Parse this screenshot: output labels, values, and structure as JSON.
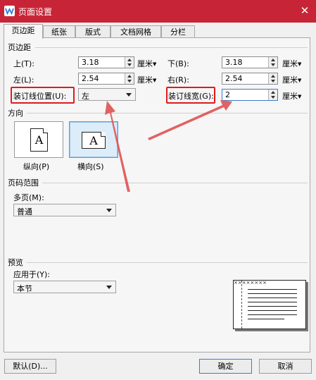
{
  "window": {
    "title": "页面设置",
    "icon": "wps-writer-icon",
    "close_glyph": "✕",
    "title_color": "#c72537"
  },
  "tabs": [
    {
      "label": "页边距",
      "active": true
    },
    {
      "label": "纸张",
      "active": false
    },
    {
      "label": "版式",
      "active": false
    },
    {
      "label": "文档网格",
      "active": false
    },
    {
      "label": "分栏",
      "active": false
    }
  ],
  "margins": {
    "section_title": "页边距",
    "top": {
      "label": "上(T):",
      "value": "3.18",
      "unit": "厘米"
    },
    "bottom": {
      "label": "下(B):",
      "value": "3.18",
      "unit": "厘米"
    },
    "left": {
      "label": "左(L):",
      "value": "2.54",
      "unit": "厘米"
    },
    "right": {
      "label": "右(R):",
      "value": "2.54",
      "unit": "厘米"
    },
    "gutter_position": {
      "label": "装订线位置(U):",
      "value": "左"
    },
    "gutter_width": {
      "label": "装订线宽(G):",
      "value": "2",
      "unit": "厘米"
    }
  },
  "orientation": {
    "section_title": "方向",
    "glyph": "A",
    "portrait_label": "纵向(P)",
    "landscape_label": "横向(S)",
    "selected": "landscape"
  },
  "page_range": {
    "section_title": "页码范围",
    "multiple_pages_label": "多页(M):",
    "multiple_pages_value": "普通"
  },
  "preview": {
    "section_title": "预览",
    "apply_to_label": "应用于(Y):",
    "apply_to_value": "本节",
    "gutter_marks": "××××××××"
  },
  "buttons": {
    "default": "默认(D)...",
    "ok": "确定",
    "cancel": "取消"
  },
  "highlight_color": "#e01b1b",
  "annotation_arrow_color": "#e05555"
}
